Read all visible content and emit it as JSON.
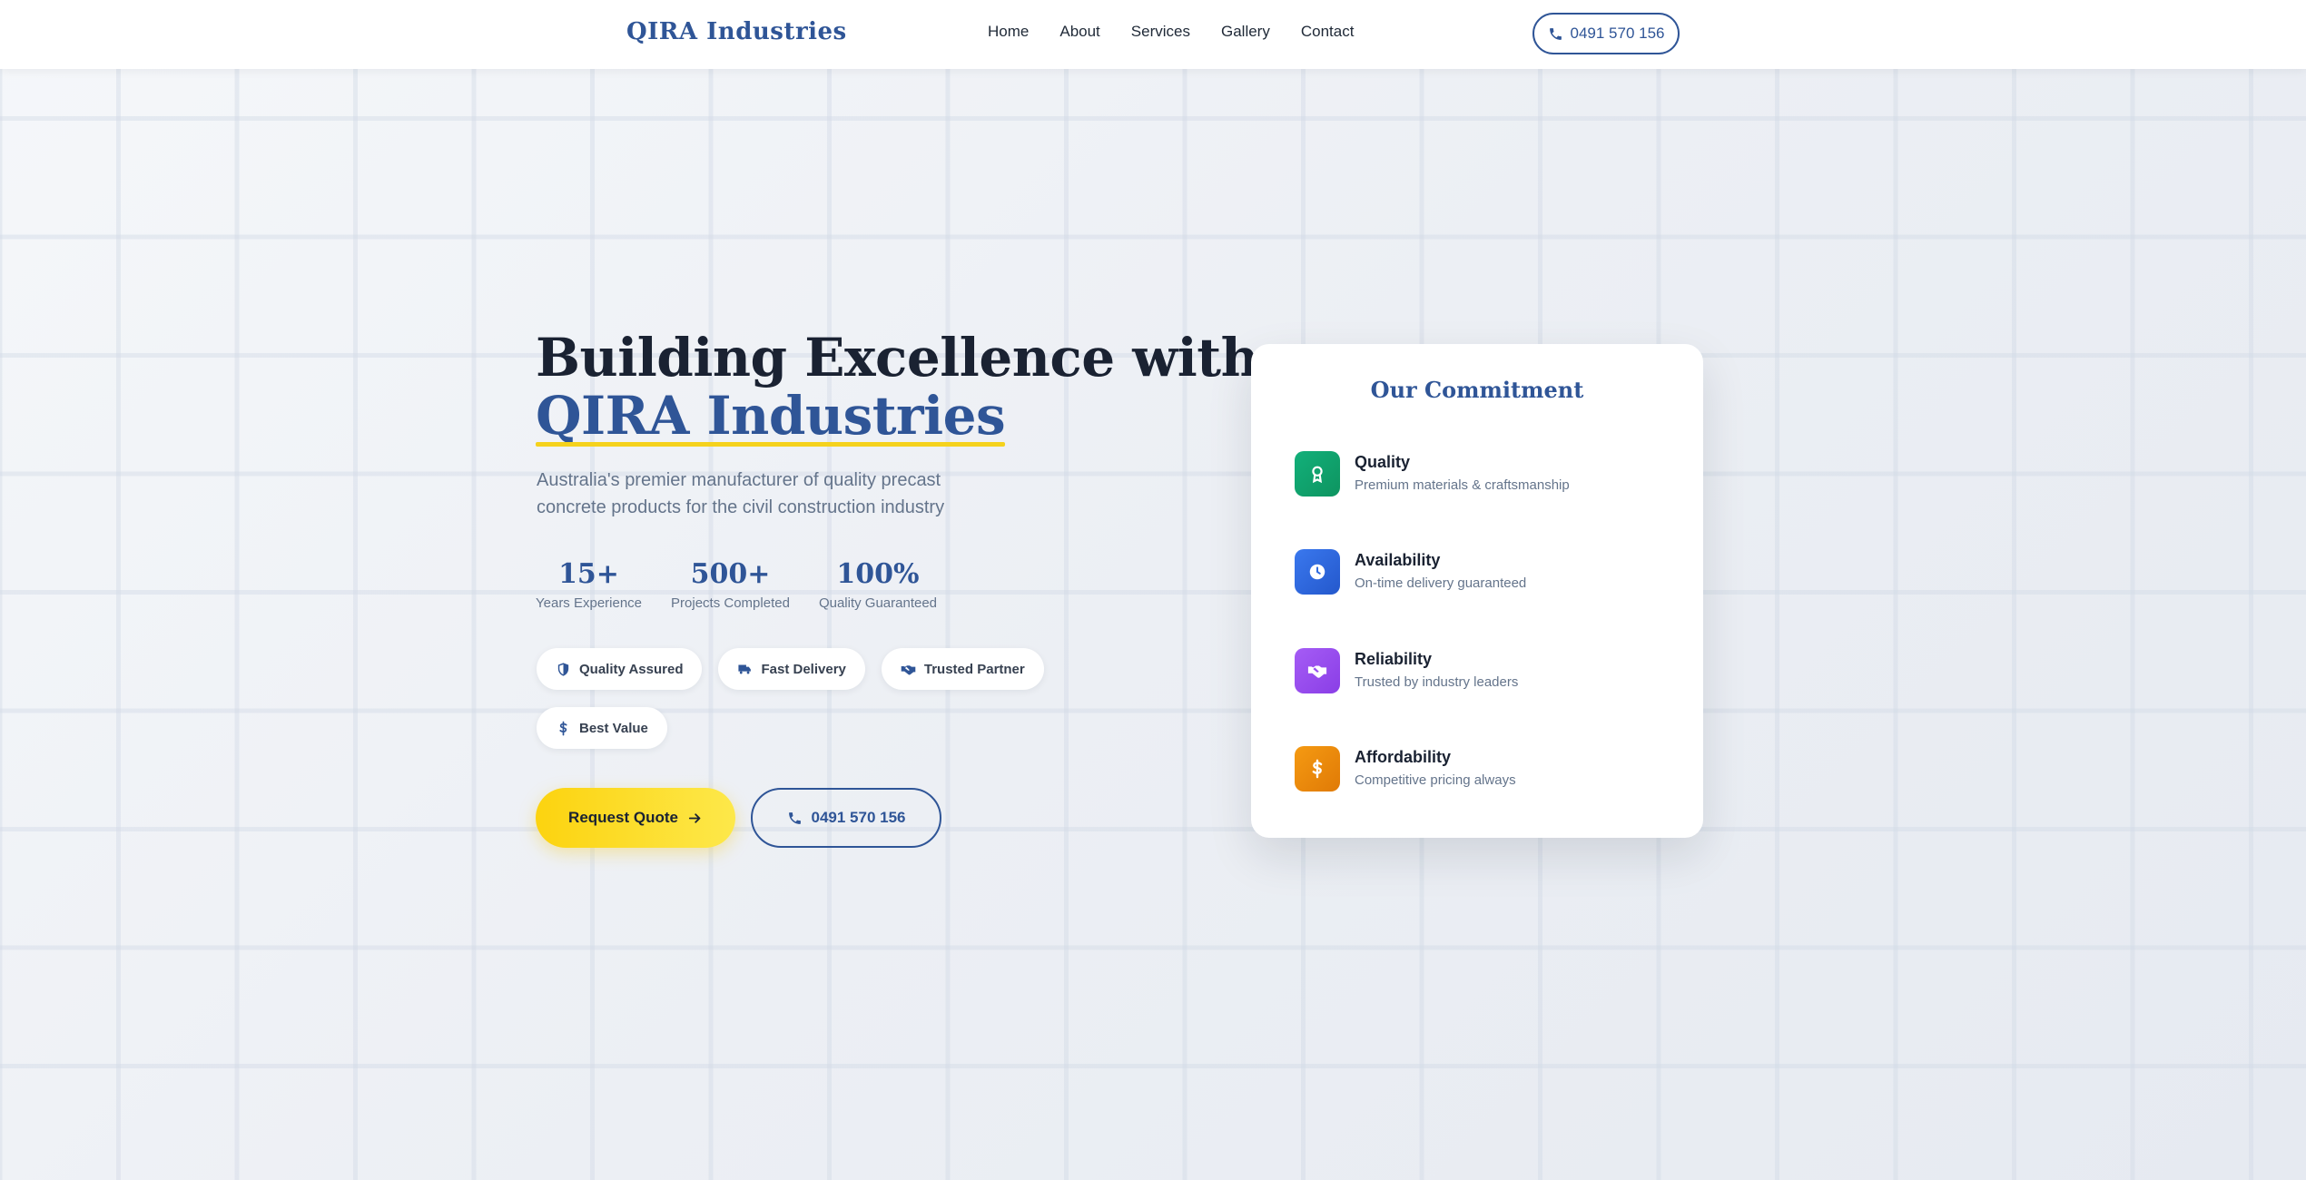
{
  "navbar": {
    "brand": "QIRA Industries",
    "links": [
      "Home",
      "About",
      "Services",
      "Gallery",
      "Contact"
    ],
    "phone": "0491 570 156"
  },
  "hero": {
    "title_line1": "Building Excellence with",
    "title_accent": "QIRA Industries",
    "subtitle": "Australia's premier manufacturer of quality precast concrete products for the civil construction industry",
    "stats": [
      {
        "value": "15+",
        "label": "Years Experience"
      },
      {
        "value": "500+",
        "label": "Projects Completed"
      },
      {
        "value": "100%",
        "label": "Quality Guaranteed"
      }
    ],
    "badges": [
      {
        "label": "Quality Assured",
        "icon": "shield-icon"
      },
      {
        "label": "Fast Delivery",
        "icon": "truck-icon"
      },
      {
        "label": "Trusted Partner",
        "icon": "handshake-icon"
      },
      {
        "label": "Best Value",
        "icon": "dollar-icon"
      }
    ],
    "cta_quote": "Request Quote",
    "cta_phone": "0491 570 156"
  },
  "commitment": {
    "title": "Our Commitment",
    "items": [
      {
        "title": "Quality",
        "desc": "Premium materials & craftsmanship",
        "icon": "award-icon",
        "color": "#10a36e"
      },
      {
        "title": "Availability",
        "desc": "On-time delivery guaranteed",
        "icon": "clock-icon",
        "color": "#2f6be0"
      },
      {
        "title": "Reliability",
        "desc": "Trusted by industry leaders",
        "icon": "handshake-icon",
        "color": "#9a4ef0"
      },
      {
        "title": "Affordability",
        "desc": "Competitive pricing always",
        "icon": "dollar-icon",
        "color": "#f08a0c"
      }
    ]
  },
  "colors": {
    "brand_blue": "#2f5597",
    "accent_yellow": "#fcd30f"
  }
}
